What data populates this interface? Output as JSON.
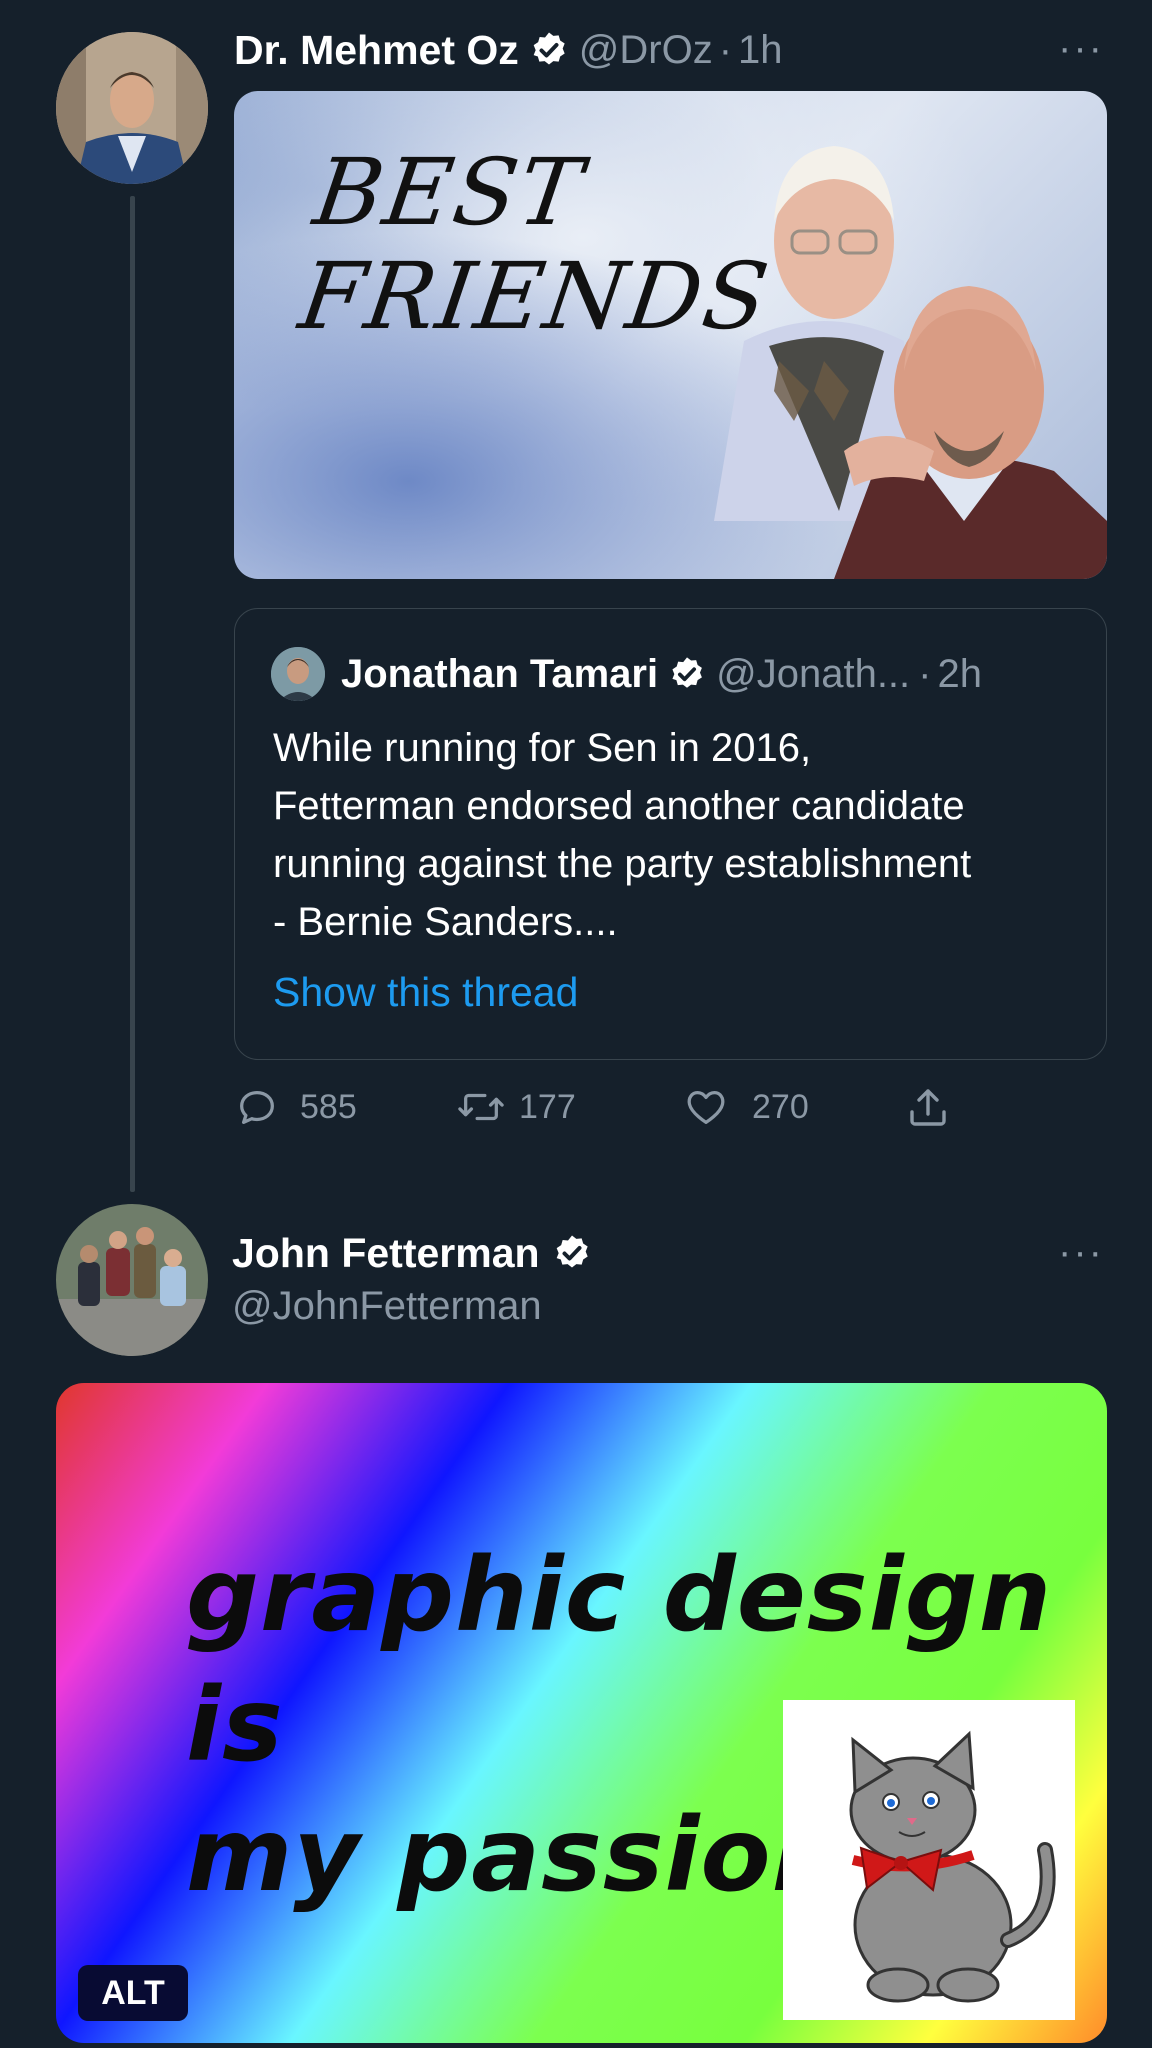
{
  "tweet1": {
    "display_name": "Dr. Mehmet Oz",
    "handle": "@DrOz",
    "separator": "·",
    "time": "1h",
    "more": "···",
    "media": {
      "line1": "BEST",
      "line2": "FRIENDS"
    },
    "quote": {
      "display_name": "Jonathan Tamari",
      "handle": "@Jonath...",
      "separator": "·",
      "time": "2h",
      "text_lines": [
        "While running for Sen in 2016,",
        "Fetterman endorsed another candidate",
        "running against the party establishment",
        "- Bernie Sanders...."
      ],
      "show_thread": "Show this thread"
    },
    "actions": {
      "replies": "585",
      "retweets": "177",
      "likes": "270"
    }
  },
  "tweet2": {
    "display_name": "John Fetterman",
    "handle": "@JohnFetterman",
    "more": "···",
    "media": {
      "line1": "graphic design is",
      "line2": "my passion.",
      "alt_badge": "ALT"
    }
  },
  "colors": {
    "background": "#15202b",
    "accent_link": "#1d9bf0",
    "muted_text": "#8b98a5",
    "border": "#38444d"
  },
  "icons": [
    "verified-badge-icon",
    "more-icon",
    "reply-icon",
    "retweet-icon",
    "like-icon",
    "share-icon"
  ]
}
